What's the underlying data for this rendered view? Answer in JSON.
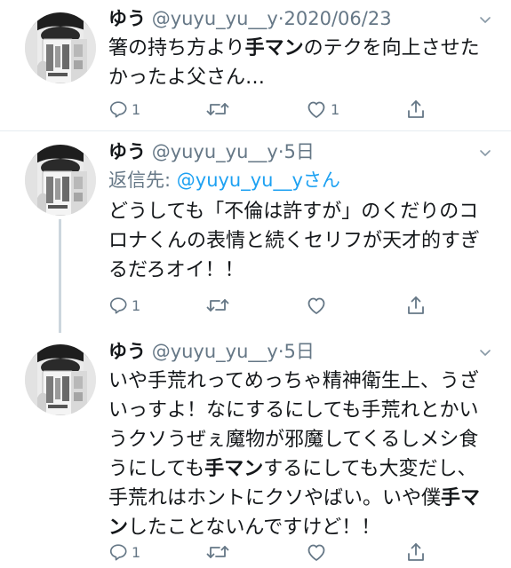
{
  "tweets": [
    {
      "name": "ゆう",
      "handle": "@yuyu_yu__y",
      "separator": "·",
      "date": "2020/06/23",
      "reply_label": "",
      "reply_mention": "",
      "reply_suffix": "",
      "text_parts": [
        {
          "t": "箸の持ち方より",
          "bold": false
        },
        {
          "t": "手マン",
          "bold": true
        },
        {
          "t": "のテクを向上させた\nかったよ父さん…",
          "bold": false
        }
      ],
      "reply_count": "1",
      "retweet_count": "",
      "like_count": "1"
    },
    {
      "name": "ゆう",
      "handle": "@yuyu_yu__y",
      "separator": "·",
      "date": "5日",
      "reply_label": "返信先: ",
      "reply_mention": "@yuyu_yu__y",
      "reply_suffix": "さん",
      "text_parts": [
        {
          "t": "どうしても「不倫は許すが」のくだりのコ\nロナくんの表情と続くセリフが天才的すぎ\nるだろオイ！！",
          "bold": false
        }
      ],
      "reply_count": "1",
      "retweet_count": "",
      "like_count": ""
    },
    {
      "name": "ゆう",
      "handle": "@yuyu_yu__y",
      "separator": "·",
      "date": "5日",
      "reply_label": "",
      "reply_mention": "",
      "reply_suffix": "",
      "text_parts": [
        {
          "t": "いや手荒れってめっちゃ精神衛生上、うざ\nいっすよ！なにするにしても手荒れとかい\nうクソうぜぇ魔物が邪魔してくるしメシ食\nうにしても",
          "bold": false
        },
        {
          "t": "手マン",
          "bold": true
        },
        {
          "t": "するにしても大変だし、\n手荒れはホントにクソやばい。いや僕",
          "bold": false
        },
        {
          "t": "手マ\nン",
          "bold": true
        },
        {
          "t": "したことないんですけど！！",
          "bold": false
        }
      ],
      "reply_count": "1",
      "retweet_count": "",
      "like_count": ""
    }
  ],
  "icons": {
    "avatar": "avatar-image",
    "menu": "chevron-down-icon",
    "reply": "reply-icon",
    "retweet": "retweet-icon",
    "like": "heart-icon",
    "share": "share-icon"
  },
  "colors": {
    "text": "#14171a",
    "secondary": "#657786",
    "link": "#1da1f2",
    "divider": "#e6ecf0",
    "thread_line": "#ccd6dd"
  }
}
